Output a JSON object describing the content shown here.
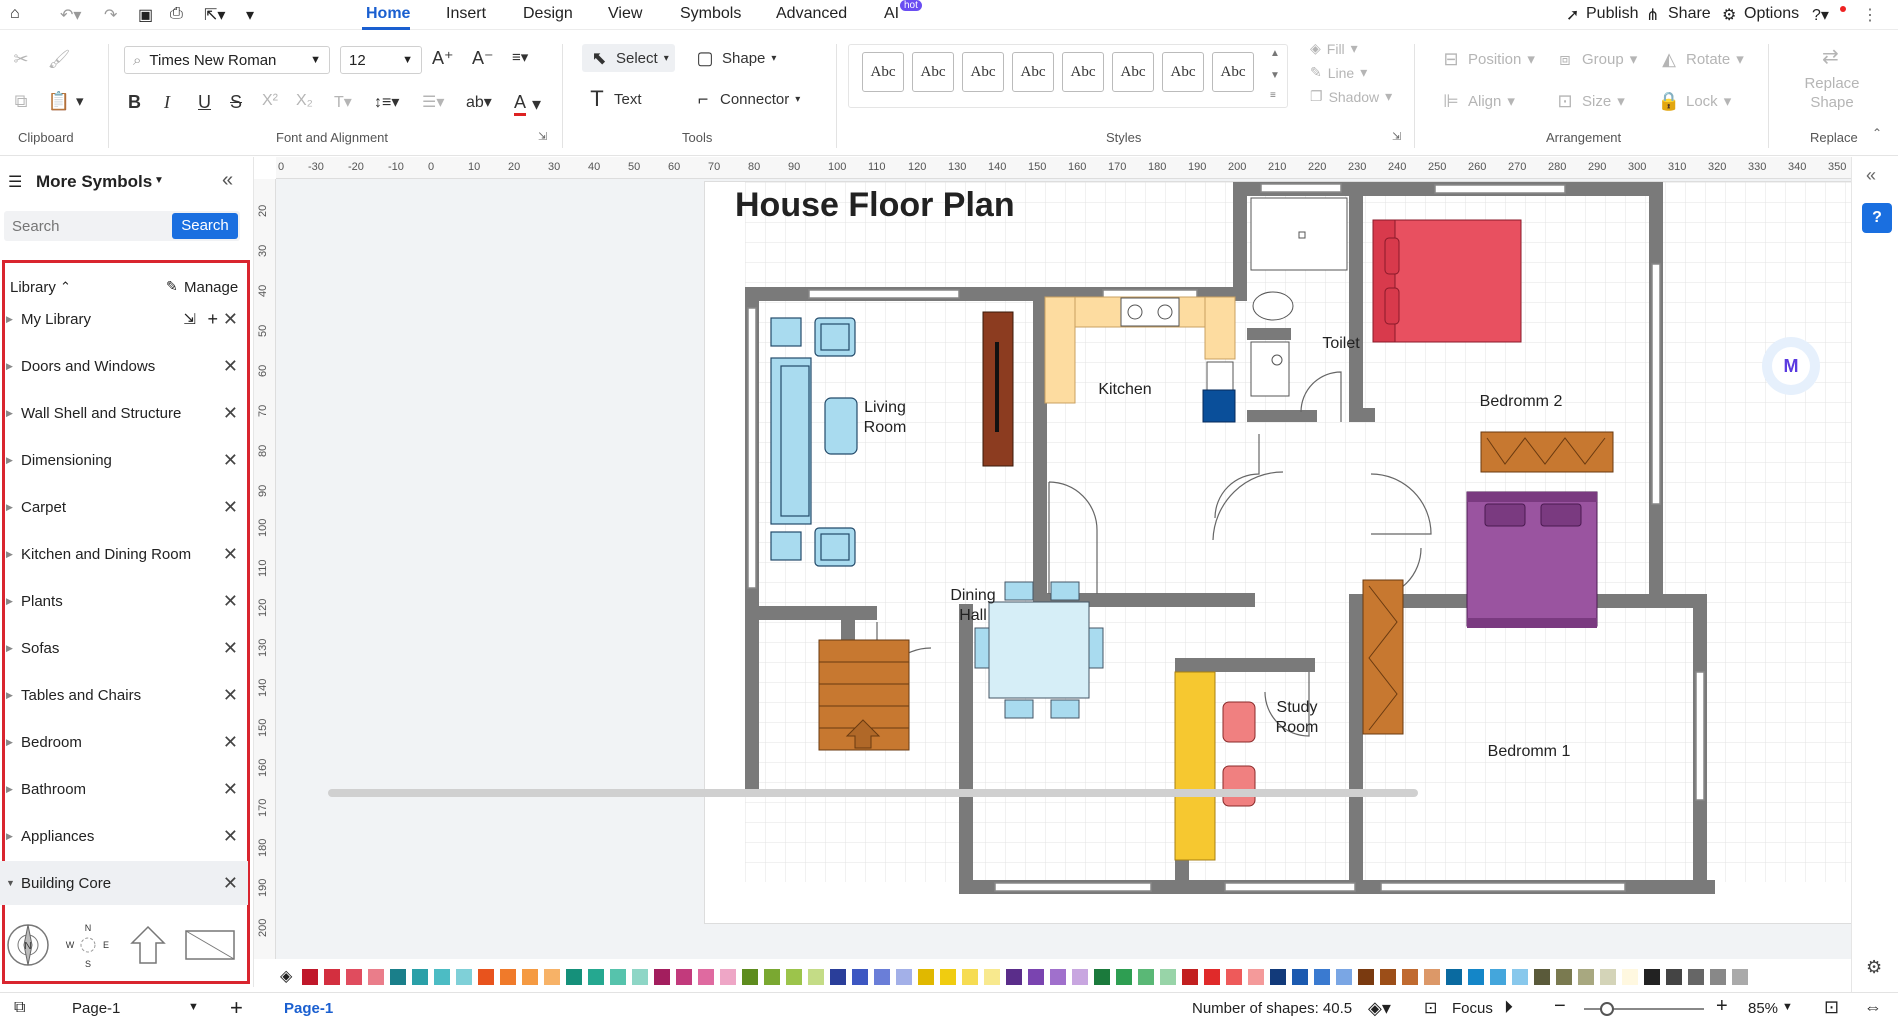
{
  "menu": {
    "tabs": [
      "Home",
      "Insert",
      "Design",
      "View",
      "Symbols",
      "Advanced",
      "AI"
    ],
    "active": "Home",
    "ai_badge": "hot",
    "publish": "Publish",
    "share": "Share",
    "options": "Options"
  },
  "ribbon": {
    "font_name": "Times New Roman",
    "font_size": "12",
    "select": "Select",
    "shape": "Shape",
    "text": "Text",
    "connector": "Connector",
    "style_sample": "Abc",
    "fill": "Fill",
    "line": "Line",
    "shadow": "Shadow",
    "position": "Position",
    "group": "Group",
    "rotate": "Rotate",
    "align": "Align",
    "size": "Size",
    "lock": "Lock",
    "replace_shape": "Replace Shape",
    "groups": {
      "clipboard": "Clipboard",
      "font": "Font and Alignment",
      "tools": "Tools",
      "styles": "Styles",
      "arrangement": "Arrangement",
      "replace": "Replace"
    }
  },
  "sidebar": {
    "title": "More Symbols",
    "search_placeholder": "Search",
    "search_button": "Search",
    "library_label": "Library",
    "manage": "Manage",
    "items": [
      "My Library",
      "Doors and Windows",
      "Wall Shell and Structure",
      "Dimensioning",
      "Carpet",
      "Kitchen and Dining Room",
      "Plants",
      "Sofas",
      "Tables and Chairs",
      "Bedroom",
      "Bathroom",
      "Appliances",
      "Building Core"
    ],
    "compass": {
      "n": "N",
      "w": "W",
      "e": "E",
      "s": "S"
    }
  },
  "ruler": {
    "h": [
      "-30",
      "-20",
      "-10",
      "0",
      "10",
      "20",
      "30",
      "40",
      "50",
      "60",
      "70",
      "80",
      "90",
      "100",
      "110",
      "120",
      "130",
      "140",
      "150",
      "160",
      "170",
      "180",
      "190",
      "200",
      "210",
      "220",
      "230",
      "240",
      "250",
      "260",
      "270",
      "280",
      "290",
      "300",
      "310",
      "320",
      "330",
      "340",
      "350"
    ],
    "h_left": "0",
    "v": [
      "20",
      "30",
      "40",
      "50",
      "60",
      "70",
      "80",
      "90",
      "100",
      "110",
      "120",
      "130",
      "140",
      "150",
      "160",
      "170",
      "180",
      "190",
      "200"
    ]
  },
  "plan": {
    "title": "House Floor Plan",
    "rooms": {
      "living": "Living\nRoom",
      "kitchen": "Kitchen",
      "toilet": "Toilet",
      "bedroom2": "Bedromm  2",
      "dining": "Dining\nHall",
      "study": "Study\nRoom",
      "bedroom1": "Bedromm  1"
    }
  },
  "palette": [
    "#c0172a",
    "#d32f3f",
    "#e04c5e",
    "#ea7d8a",
    "#1a7f8a",
    "#2aa0a8",
    "#4cbcc4",
    "#7fd0d8",
    "#e8531d",
    "#f07a2a",
    "#f59a42",
    "#f7b267",
    "#15907a",
    "#25a890",
    "#56c3ac",
    "#8ed6c6",
    "#a31e5e",
    "#c23a7c",
    "#df6aa0",
    "#eea6c6",
    "#5e8c1e",
    "#7aa831",
    "#9cc44b",
    "#c4dc86",
    "#2a3e9a",
    "#3d57c2",
    "#6a7ed8",
    "#a3b0e8",
    "#e0b800",
    "#f0cc10",
    "#f6dc52",
    "#f8e98e",
    "#5a2d8a",
    "#7a44b0",
    "#a070cc",
    "#c8a6e0",
    "#1b7a3c",
    "#2e9e52",
    "#5ab876",
    "#98d4a8",
    "#c22020",
    "#e02a2a",
    "#ee5a5a",
    "#f49a9a",
    "#123a7a",
    "#1c5ab0",
    "#3a7ad0",
    "#7aa6e4",
    "#7a3a10",
    "#9c4e18",
    "#c06a30",
    "#dc9868",
    "#0a6aa0",
    "#1486c8",
    "#44a6dc",
    "#88c8ec",
    "#5a5a3a",
    "#7a7a50",
    "#a8a880",
    "#d4d4b8",
    "#fff8e0",
    "#222",
    "#444",
    "#666",
    "#888",
    "#aaa"
  ],
  "status": {
    "page_tab": "Page-1",
    "page_active": "Page-1",
    "shapes": "Number of shapes: 40.5",
    "focus": "Focus",
    "zoom": "85%"
  }
}
